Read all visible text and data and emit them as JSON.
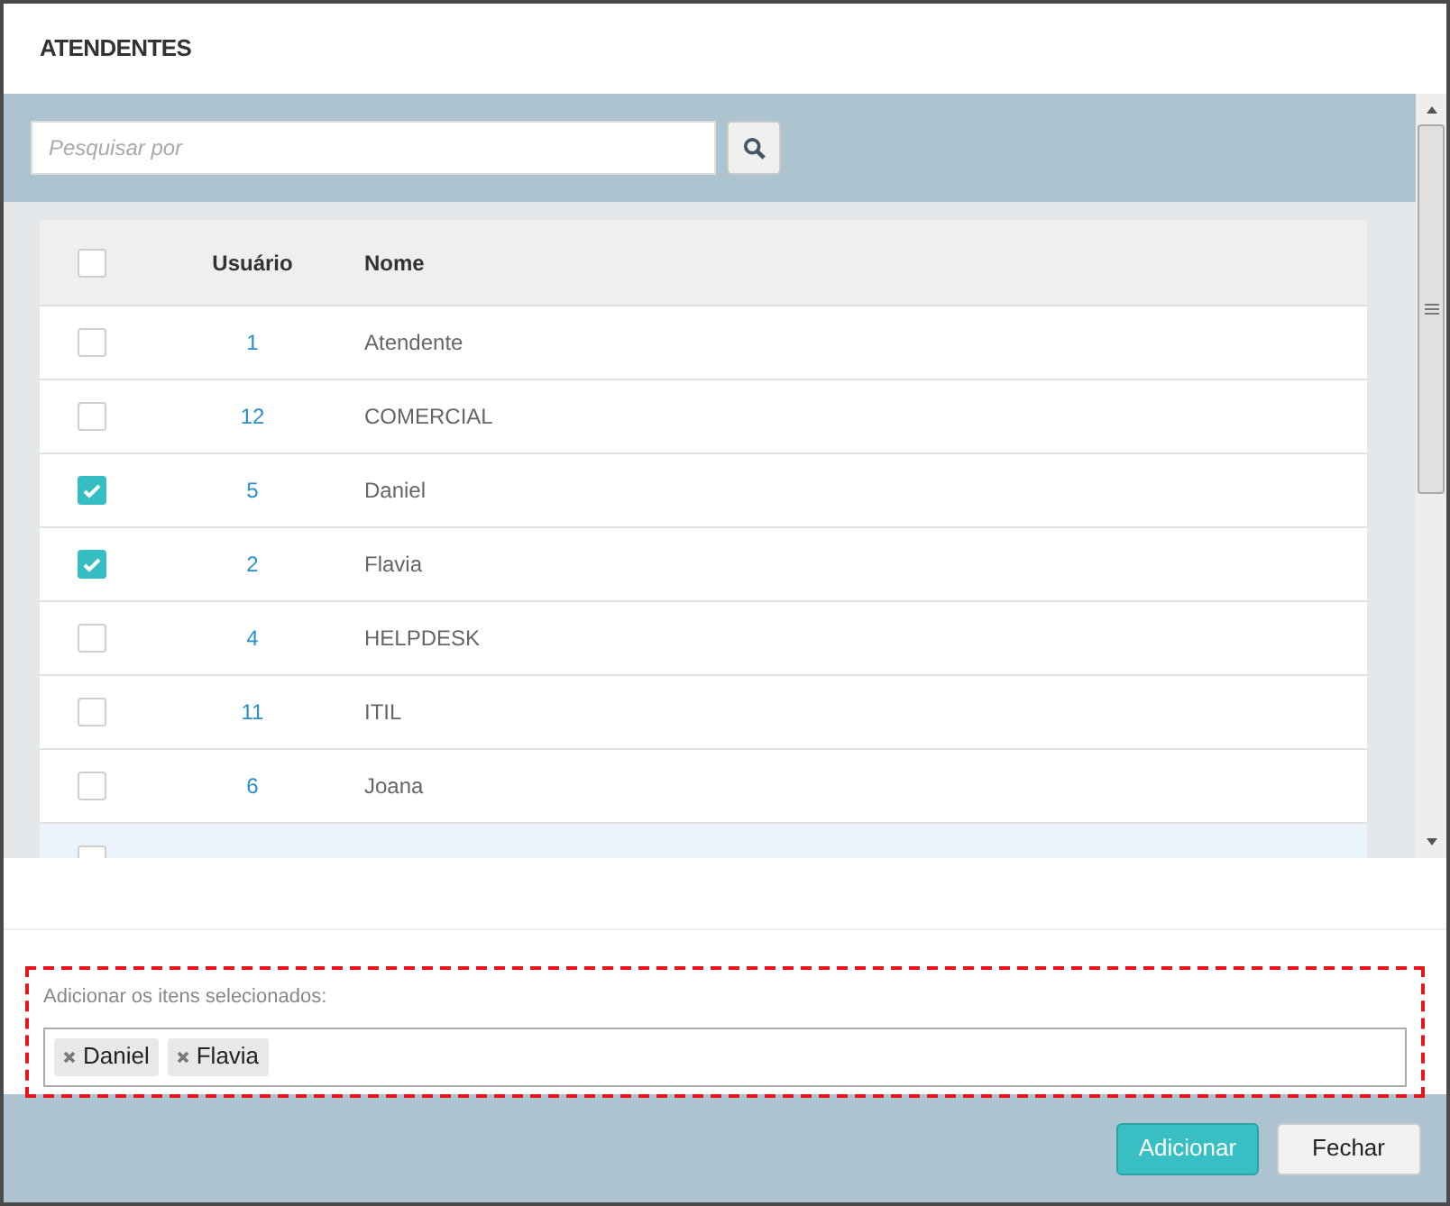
{
  "dialog": {
    "title": "ATENDENTES"
  },
  "search": {
    "placeholder": "Pesquisar por"
  },
  "table": {
    "select_all": {
      "checked": false
    },
    "columns": [
      "Usuário",
      "Nome"
    ],
    "rows": [
      {
        "user": "1",
        "name": "Atendente",
        "checked": false,
        "highlighted": false
      },
      {
        "user": "12",
        "name": "COMERCIAL",
        "checked": false,
        "highlighted": false
      },
      {
        "user": "5",
        "name": "Daniel",
        "checked": true,
        "highlighted": false
      },
      {
        "user": "2",
        "name": "Flavia",
        "checked": true,
        "highlighted": false
      },
      {
        "user": "4",
        "name": "HELPDESK",
        "checked": false,
        "highlighted": false
      },
      {
        "user": "11",
        "name": "ITIL",
        "checked": false,
        "highlighted": false
      },
      {
        "user": "6",
        "name": "Joana",
        "checked": false,
        "highlighted": false
      },
      {
        "checked": false,
        "highlighted": true
      }
    ]
  },
  "selection": {
    "label": "Adicionar os itens selecionados:",
    "tags": [
      "Daniel",
      "Flavia"
    ]
  },
  "buttons": [
    {
      "label": "Adicionar",
      "kind": "primary"
    },
    {
      "label": "Fechar",
      "kind": "secondary"
    }
  ]
}
